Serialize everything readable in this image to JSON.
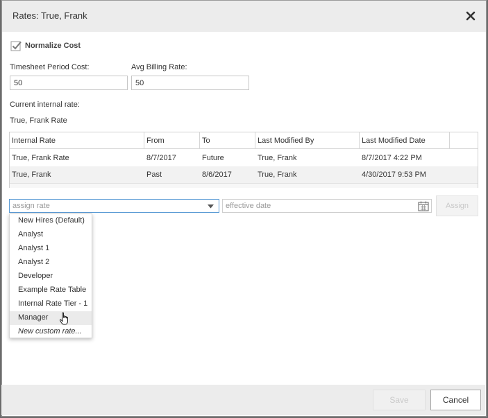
{
  "dialog": {
    "title": "Rates: True, Frank",
    "close_icon": "close-icon"
  },
  "normalize": {
    "label": "Normalize Cost",
    "checked": true
  },
  "fields": {
    "timesheet_cost_label": "Timesheet Period Cost:",
    "timesheet_cost_value": "50",
    "avg_billing_label": "Avg Billing Rate:",
    "avg_billing_value": "50"
  },
  "current_rate": {
    "label": "Current internal rate:",
    "value": "True, Frank Rate"
  },
  "table": {
    "headers": [
      "Internal Rate",
      "From",
      "To",
      "Last Modified By",
      "Last Modified Date"
    ],
    "rows": [
      [
        "True, Frank Rate",
        "8/7/2017",
        "Future",
        "True, Frank",
        "8/7/2017 4:22 PM"
      ],
      [
        "True, Frank",
        "Past",
        "8/6/2017",
        "True, Frank",
        "4/30/2017 9:53 PM"
      ]
    ]
  },
  "assign": {
    "rate_placeholder": "assign rate",
    "date_placeholder": "effective date",
    "button_label": "Assign"
  },
  "dropdown": {
    "options": [
      "New Hires (Default)",
      "Analyst",
      "Analyst 1",
      "Analyst 2",
      "Developer",
      "Example Rate Table",
      "Internal Rate Tier - 1",
      "Manager",
      "New custom rate..."
    ],
    "hovered": "Manager"
  },
  "footer": {
    "save_label": "Save",
    "cancel_label": "Cancel"
  },
  "colors": {
    "focus_border": "#5b9bd5",
    "header_bg": "#ececec"
  }
}
